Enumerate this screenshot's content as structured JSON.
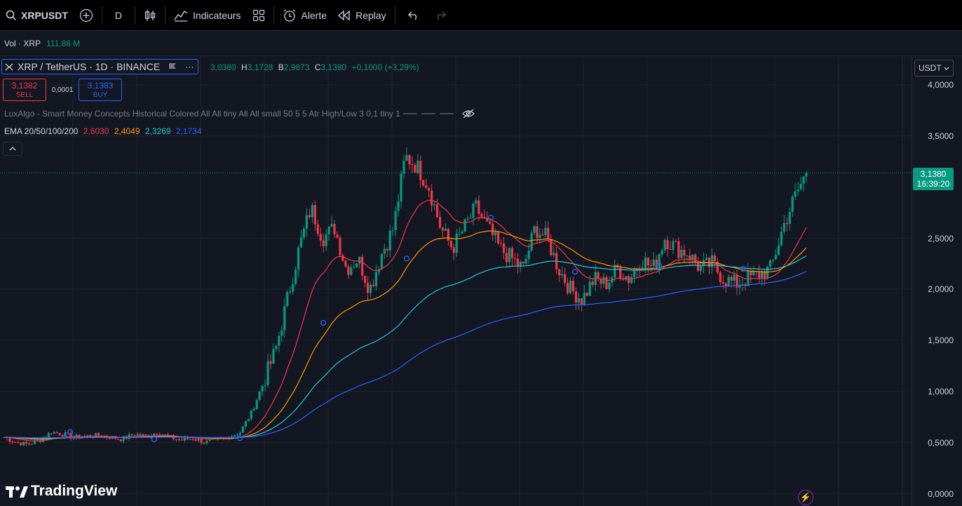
{
  "toolbar": {
    "symbol": "XRPUSDT",
    "interval": "D",
    "indicators_label": "Indicateurs",
    "alert_label": "Alerte",
    "replay_label": "Replay"
  },
  "subbar": {
    "vol_label": "Vol · XRP",
    "vol_value": "111,86 M"
  },
  "legend": {
    "pair": "XRP / TetherUS · 1D · BINANCE",
    "more": "···",
    "o_val": "3,0380",
    "h_label": "H",
    "h_val": "3,1728",
    "b_label": "B",
    "b_val": "2,9873",
    "c_label": "C",
    "c_val": "3,1380",
    "change": "+0,1000 (+3,29%)"
  },
  "trade": {
    "sell_price": "3,1382",
    "sell_label": "SELL",
    "spread": "0,0001",
    "buy_price": "3,1383",
    "buy_label": "BUY"
  },
  "indicator": {
    "luxalgo": "LuxAlgo - Smart Money Concepts Historical Colored All All tiny All All small 50 5 5 Atr High/Low 3 0,1 tiny 1",
    "ema_label": "EMA 20/50/100/200",
    "ema20": "2,6030",
    "ema50": "2,4049",
    "ema100": "2,3269",
    "ema200": "2,1734"
  },
  "colors": {
    "up": "#089981",
    "down": "#f23645",
    "ema20": "#f23645",
    "ema50": "#ff9800",
    "ema100": "#26c6da",
    "ema200": "#2962ff",
    "background": "#131722"
  },
  "axis": {
    "currency": "USDT",
    "ticks": [
      "4,0000",
      "3,5000",
      "2,5000",
      "2,0000",
      "1,5000",
      "1,0000",
      "0,5000",
      "0,0000"
    ],
    "last_price": "3,1380",
    "countdown": "16:39:20"
  },
  "branding": {
    "logo_text": "TradingView"
  },
  "chart_data": {
    "type": "candlestick",
    "symbol": "XRPUSDT",
    "interval": "1D",
    "ylim": [
      0,
      4.0
    ],
    "last_close": 3.138,
    "close_path": [
      0.55,
      0.5,
      0.48,
      0.52,
      0.6,
      0.58,
      0.55,
      0.56,
      0.57,
      0.55,
      0.53,
      0.58,
      0.56,
      0.6,
      0.55,
      0.52,
      0.54,
      0.5,
      0.52,
      0.55,
      0.6,
      0.8,
      1.1,
      1.4,
      1.9,
      2.4,
      2.8,
      2.5,
      2.6,
      2.2,
      2.3,
      2.0,
      2.35,
      2.6,
      3.3,
      3.2,
      3.0,
      2.6,
      2.4,
      2.6,
      2.8,
      2.6,
      2.4,
      2.3,
      2.2,
      2.6,
      2.5,
      2.2,
      2.0,
      1.9,
      2.1,
      2.05,
      2.2,
      2.1,
      2.3,
      2.2,
      2.5,
      2.4,
      2.35,
      2.2,
      2.25,
      2.1,
      2.05,
      2.1,
      2.15,
      2.2,
      2.6,
      2.9,
      3.14
    ],
    "ema20_end": 2.603,
    "ema50_end": 2.4049,
    "ema100_end": 2.3269,
    "ema200_end": 2.1734
  }
}
